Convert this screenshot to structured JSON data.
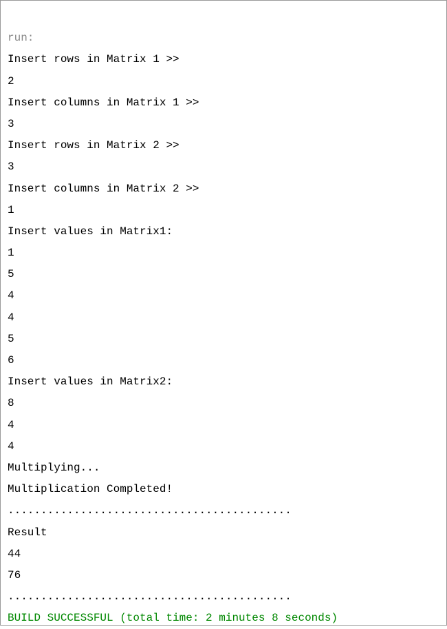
{
  "console": {
    "header": "run:",
    "lines": [
      "Insert rows in Matrix 1 >>",
      "2",
      "Insert columns in Matrix 1 >>",
      "3",
      "Insert rows in Matrix 2 >>",
      "3",
      "Insert columns in Matrix 2 >>",
      "1",
      "Insert values in Matrix1:",
      "1",
      "5",
      "4",
      "4",
      "5",
      "6",
      "Insert values in Matrix2:",
      "8",
      "4",
      "4",
      "Multiplying...",
      "Multiplication Completed!",
      "...........................................",
      "Result",
      "44",
      "76",
      "..........................................."
    ],
    "footer": "BUILD SUCCESSFUL (total time: 2 minutes 8 seconds)"
  }
}
